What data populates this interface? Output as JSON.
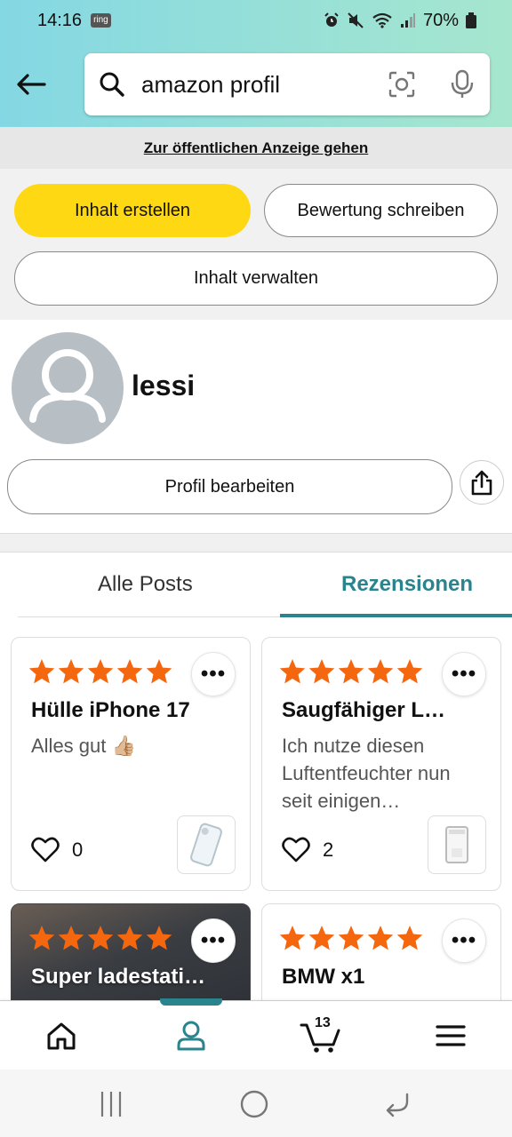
{
  "status_bar": {
    "time": "14:16",
    "ring_badge": "ring",
    "battery": "70%"
  },
  "search": {
    "query": "amazon profil",
    "icons": [
      "back-arrow-icon",
      "search-icon",
      "camera-lens-icon",
      "microphone-icon"
    ]
  },
  "public_view_link": "Zur öffentlichen Anzeige gehen",
  "actions": {
    "create_content": "Inhalt erstellen",
    "write_review": "Bewertung schreiben",
    "manage_content": "Inhalt verwalten"
  },
  "profile": {
    "username": "lessi",
    "edit_button": "Profil bearbeiten"
  },
  "tabs": [
    {
      "label": "Alle Posts",
      "active": false
    },
    {
      "label": "Rezensionen",
      "active": true
    }
  ],
  "reviews": [
    {
      "rating": 5,
      "title": "Hülle iPhone 17",
      "text": "Alles gut 👍🏼",
      "likes": "0",
      "product_icon": "phone-case-thumbnail"
    },
    {
      "rating": 5,
      "title": "Saugfähiger Lu…",
      "text": "Ich nutze diesen Luftentfeuchter nun seit einigen…",
      "likes": "2",
      "product_icon": "dehumidifier-thumbnail"
    },
    {
      "rating": 5,
      "title": "Super ladestati…",
      "text": "",
      "likes": "",
      "product_icon": ""
    },
    {
      "rating": 5,
      "title": "BMW x1",
      "text": "",
      "likes": "",
      "product_icon": ""
    }
  ],
  "more_label": "•••",
  "bottom_nav": {
    "items": [
      "home-icon",
      "account-icon",
      "cart-icon",
      "menu-icon"
    ],
    "cart_count": "13",
    "active": "account-icon"
  },
  "colors": {
    "header_gradient_start": "#84d8e3",
    "header_gradient_end": "#a6e6ce",
    "primary_button": "#ffd814",
    "accent_teal": "#2a848e",
    "star_orange": "#f5670f"
  }
}
